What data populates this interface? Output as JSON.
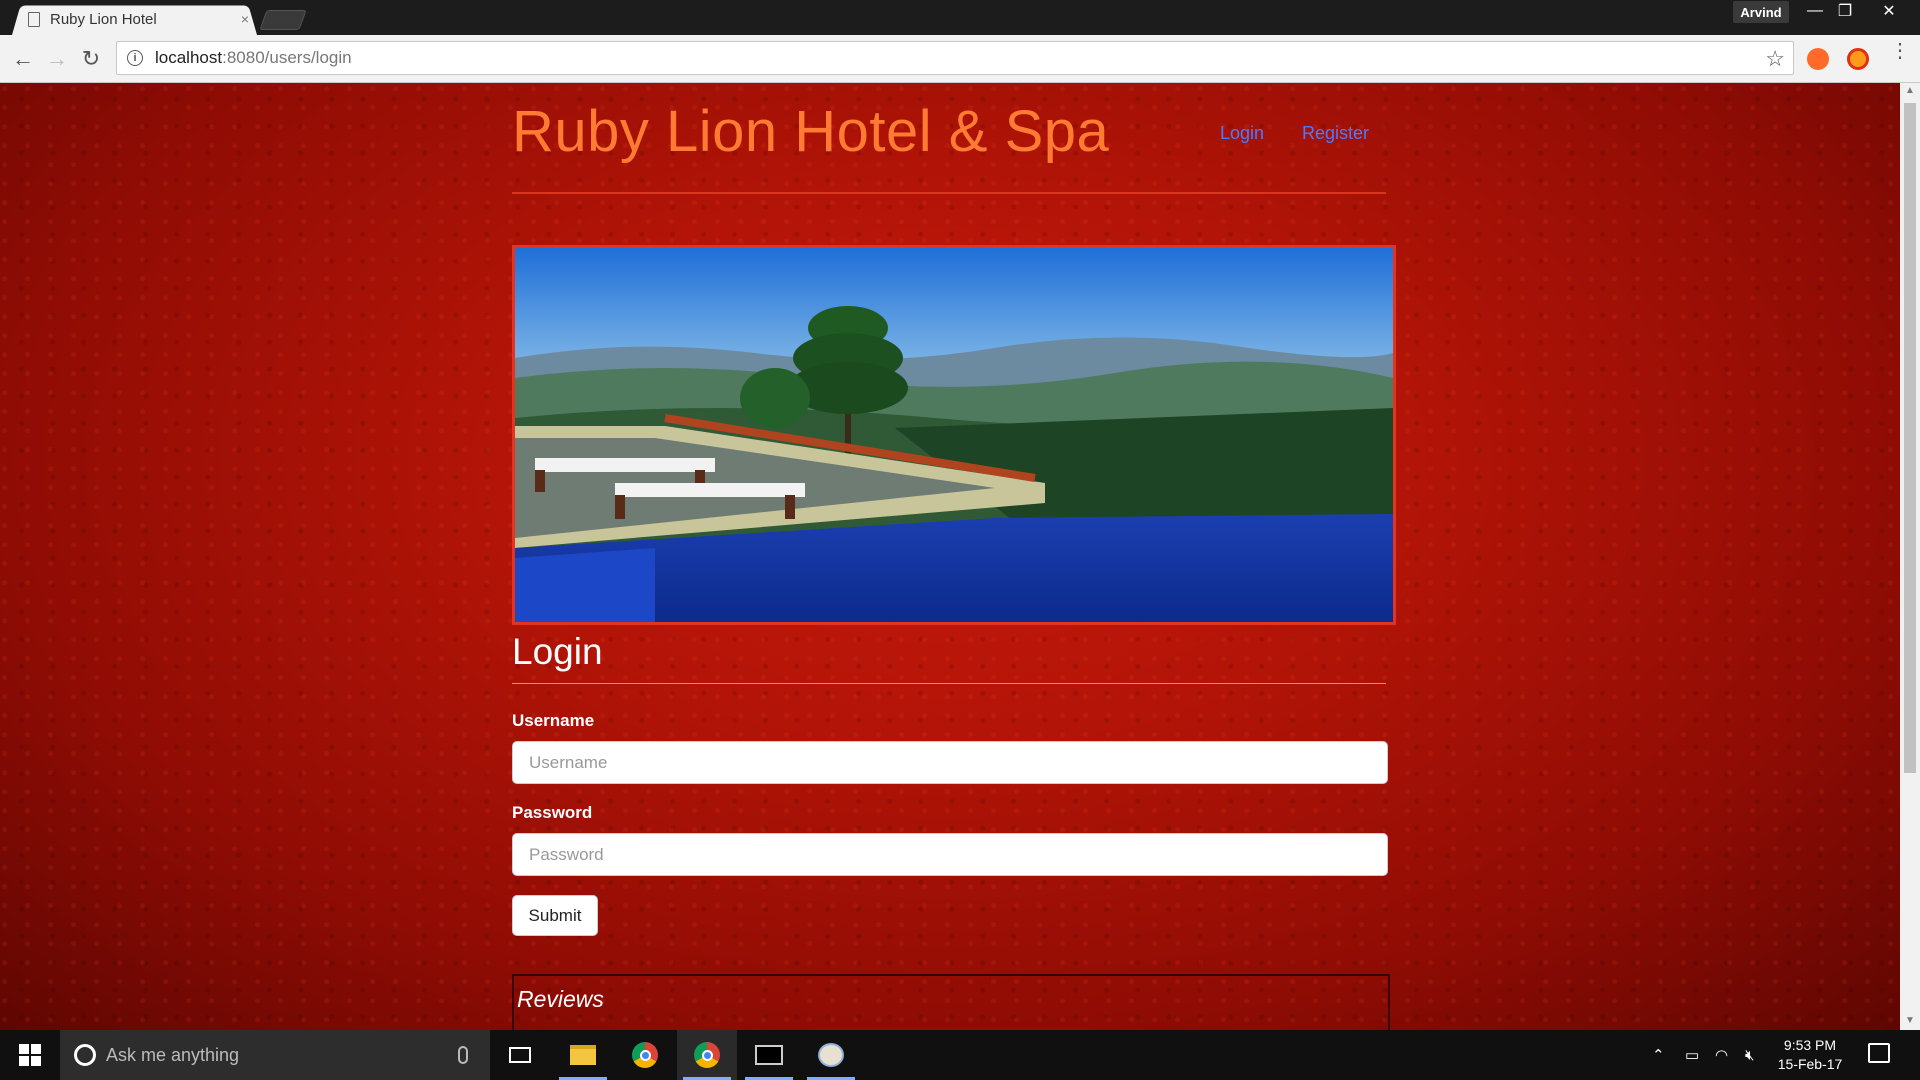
{
  "browser": {
    "tab_title": "Ruby Lion Hotel",
    "tab_close": "×",
    "profile_name": "Arvind",
    "url_host": "localhost",
    "url_rest": ":8080/users/login"
  },
  "site": {
    "brand": "Ruby Lion Hotel & Spa",
    "nav": {
      "login": "Login",
      "register": "Register"
    },
    "login_heading": "Login",
    "username_label": "Username",
    "username_placeholder": "Username",
    "password_label": "Password",
    "password_placeholder": "Password",
    "submit_label": "Submit",
    "reviews_heading": "Reviews"
  },
  "taskbar": {
    "search_placeholder": "Ask me anything",
    "time": "9:53 PM",
    "date": "15-Feb-17"
  },
  "colors": {
    "brand": "#ff7a33",
    "nav_link": "#4d79ff",
    "background_red": "#b21407"
  },
  "icons": [
    "page-icon",
    "back-arrow-icon",
    "forward-arrow-icon",
    "reload-icon",
    "info-icon",
    "star-icon",
    "menu-icon",
    "windows-icon",
    "cortana-icon",
    "mic-icon",
    "task-view-icon",
    "file-explorer-icon",
    "chrome-icon",
    "terminal-icon",
    "paint-icon",
    "chevron-up-icon",
    "battery-icon",
    "wifi-icon",
    "volume-muted-icon",
    "notifications-icon"
  ]
}
